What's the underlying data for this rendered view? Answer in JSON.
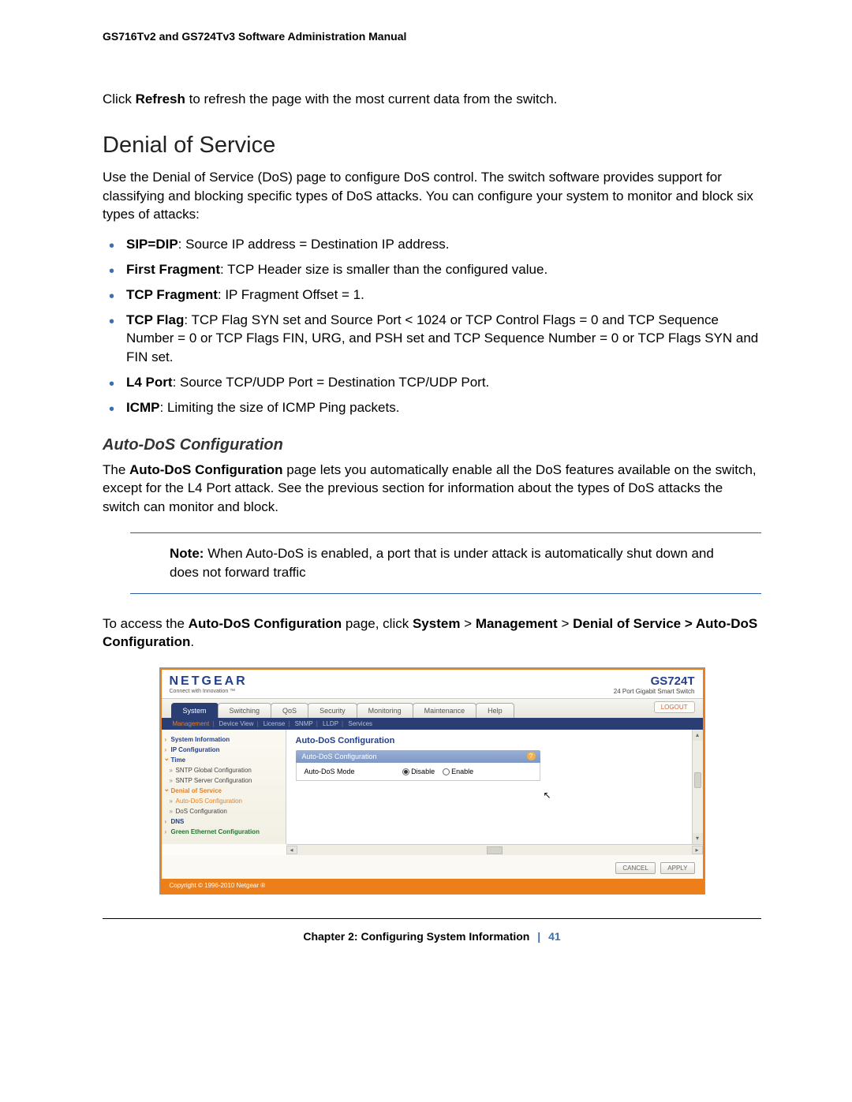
{
  "header": {
    "title": "GS716Tv2 and GS724Tv3 Software Administration Manual"
  },
  "intro": {
    "prefix": "Click ",
    "bold": "Refresh",
    "suffix": " to refresh the page with the most current data from the switch."
  },
  "section": {
    "heading": "Denial of Service",
    "intro": "Use the Denial of Service (DoS) page to configure DoS control. The switch software provides support for classifying and blocking specific types of DoS attacks. You can configure your system to monitor and block six types of attacks:",
    "items": [
      {
        "bold": "SIP=DIP",
        "text": ": Source IP address = Destination IP address."
      },
      {
        "bold": "First Fragment",
        "text": ": TCP Header size is smaller than the configured value."
      },
      {
        "bold": "TCP Fragment",
        "text": ": IP Fragment Offset = 1."
      },
      {
        "bold": "TCP Flag",
        "text": ": TCP Flag SYN set and Source Port < 1024 or TCP Control Flags = 0 and TCP Sequence Number = 0 or TCP Flags FIN, URG, and PSH set and TCP Sequence Number = 0 or TCP Flags SYN and FIN set."
      },
      {
        "bold": "L4 Port",
        "text": ": Source TCP/UDP Port = Destination TCP/UDP Port."
      },
      {
        "bold": "ICMP",
        "text": ": Limiting the size of ICMP Ping packets."
      }
    ]
  },
  "subsection": {
    "heading": "Auto-DoS Configuration",
    "text_prefix": "The ",
    "text_bold": "Auto-DoS Configuration",
    "text_suffix": " page lets you automatically enable all the DoS features available on the switch, except for the L4 Port attack. See the previous section for information about the types of DoS attacks the switch can monitor and block."
  },
  "note": {
    "label": "Note:",
    "text": "When Auto-DoS is enabled, a port that is under attack is automatically shut down and does not forward traffic"
  },
  "access": {
    "prefix": "To access the ",
    "b1": "Auto-DoS Configuration",
    "mid1": " page, click ",
    "b2": "System",
    "gt1": " > ",
    "b3": "Management",
    "gt2": " > ",
    "b4": "Denial of Service > Auto-DoS Configuration",
    "suffix": "."
  },
  "screenshot": {
    "logo": "NETGEAR",
    "logo_tag": "Connect with Innovation ™",
    "model": "GS724T",
    "model_desc": "24 Port Gigabit Smart Switch",
    "tabs": [
      "System",
      "Switching",
      "QoS",
      "Security",
      "Monitoring",
      "Maintenance",
      "Help"
    ],
    "logout": "LOGOUT",
    "subtabs": [
      "Management",
      "Device View",
      "License",
      "SNMP",
      "LLDP",
      "Services"
    ],
    "sidebar": {
      "sys_info": "System Information",
      "ip_config": "IP Configuration",
      "time": "Time",
      "sntp_global": "SNTP Global Configuration",
      "sntp_server": "SNTP Server Configuration",
      "dos": "Denial of Service",
      "auto_dos": "Auto-DoS Configuration",
      "dos_config": "DoS Configuration",
      "dns": "DNS",
      "green": "Green Ethernet Configuration"
    },
    "main": {
      "title": "Auto-DoS Configuration",
      "bar_title": "Auto-DoS Configuration",
      "help": "?",
      "mode_label": "Auto-DoS Mode",
      "disable": "Disable",
      "enable": "Enable"
    },
    "buttons": {
      "cancel": "CANCEL",
      "apply": "APPLY"
    },
    "copyright": "Copyright © 1996-2010 Netgear ®"
  },
  "footer": {
    "chapter": "Chapter 2:  Configuring System Information",
    "page": "41"
  }
}
